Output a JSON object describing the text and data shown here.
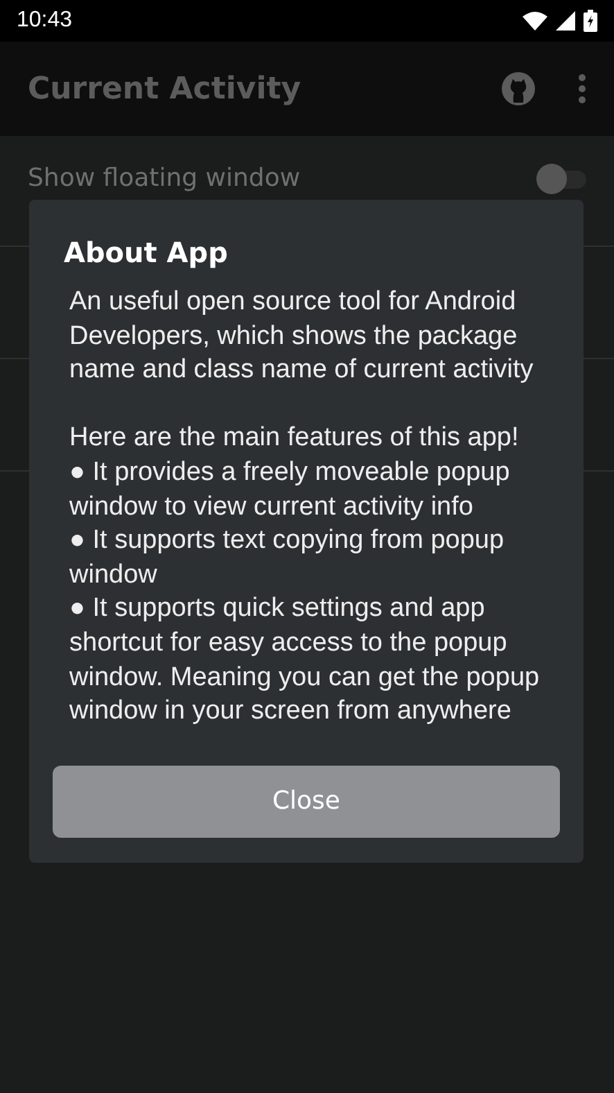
{
  "status_bar": {
    "time": "10:43"
  },
  "app_bar": {
    "title": "Current Activity"
  },
  "settings": [
    {
      "kind": "switch",
      "label": "Show floating window",
      "on": false
    }
  ],
  "dialog": {
    "title": "About App",
    "paragraphs": [
      "An useful open source tool for Android Developers, which shows the package name and class name of current activity",
      "Here are the main features of this app!"
    ],
    "features": [
      "● It provides a freely moveable popup window to view current activity info",
      "● It supports text copying from popup window",
      "● It supports quick settings and app shortcut for easy access to the popup window. Meaning you can get the popup window in your screen from anywhere"
    ],
    "button": "Close"
  }
}
